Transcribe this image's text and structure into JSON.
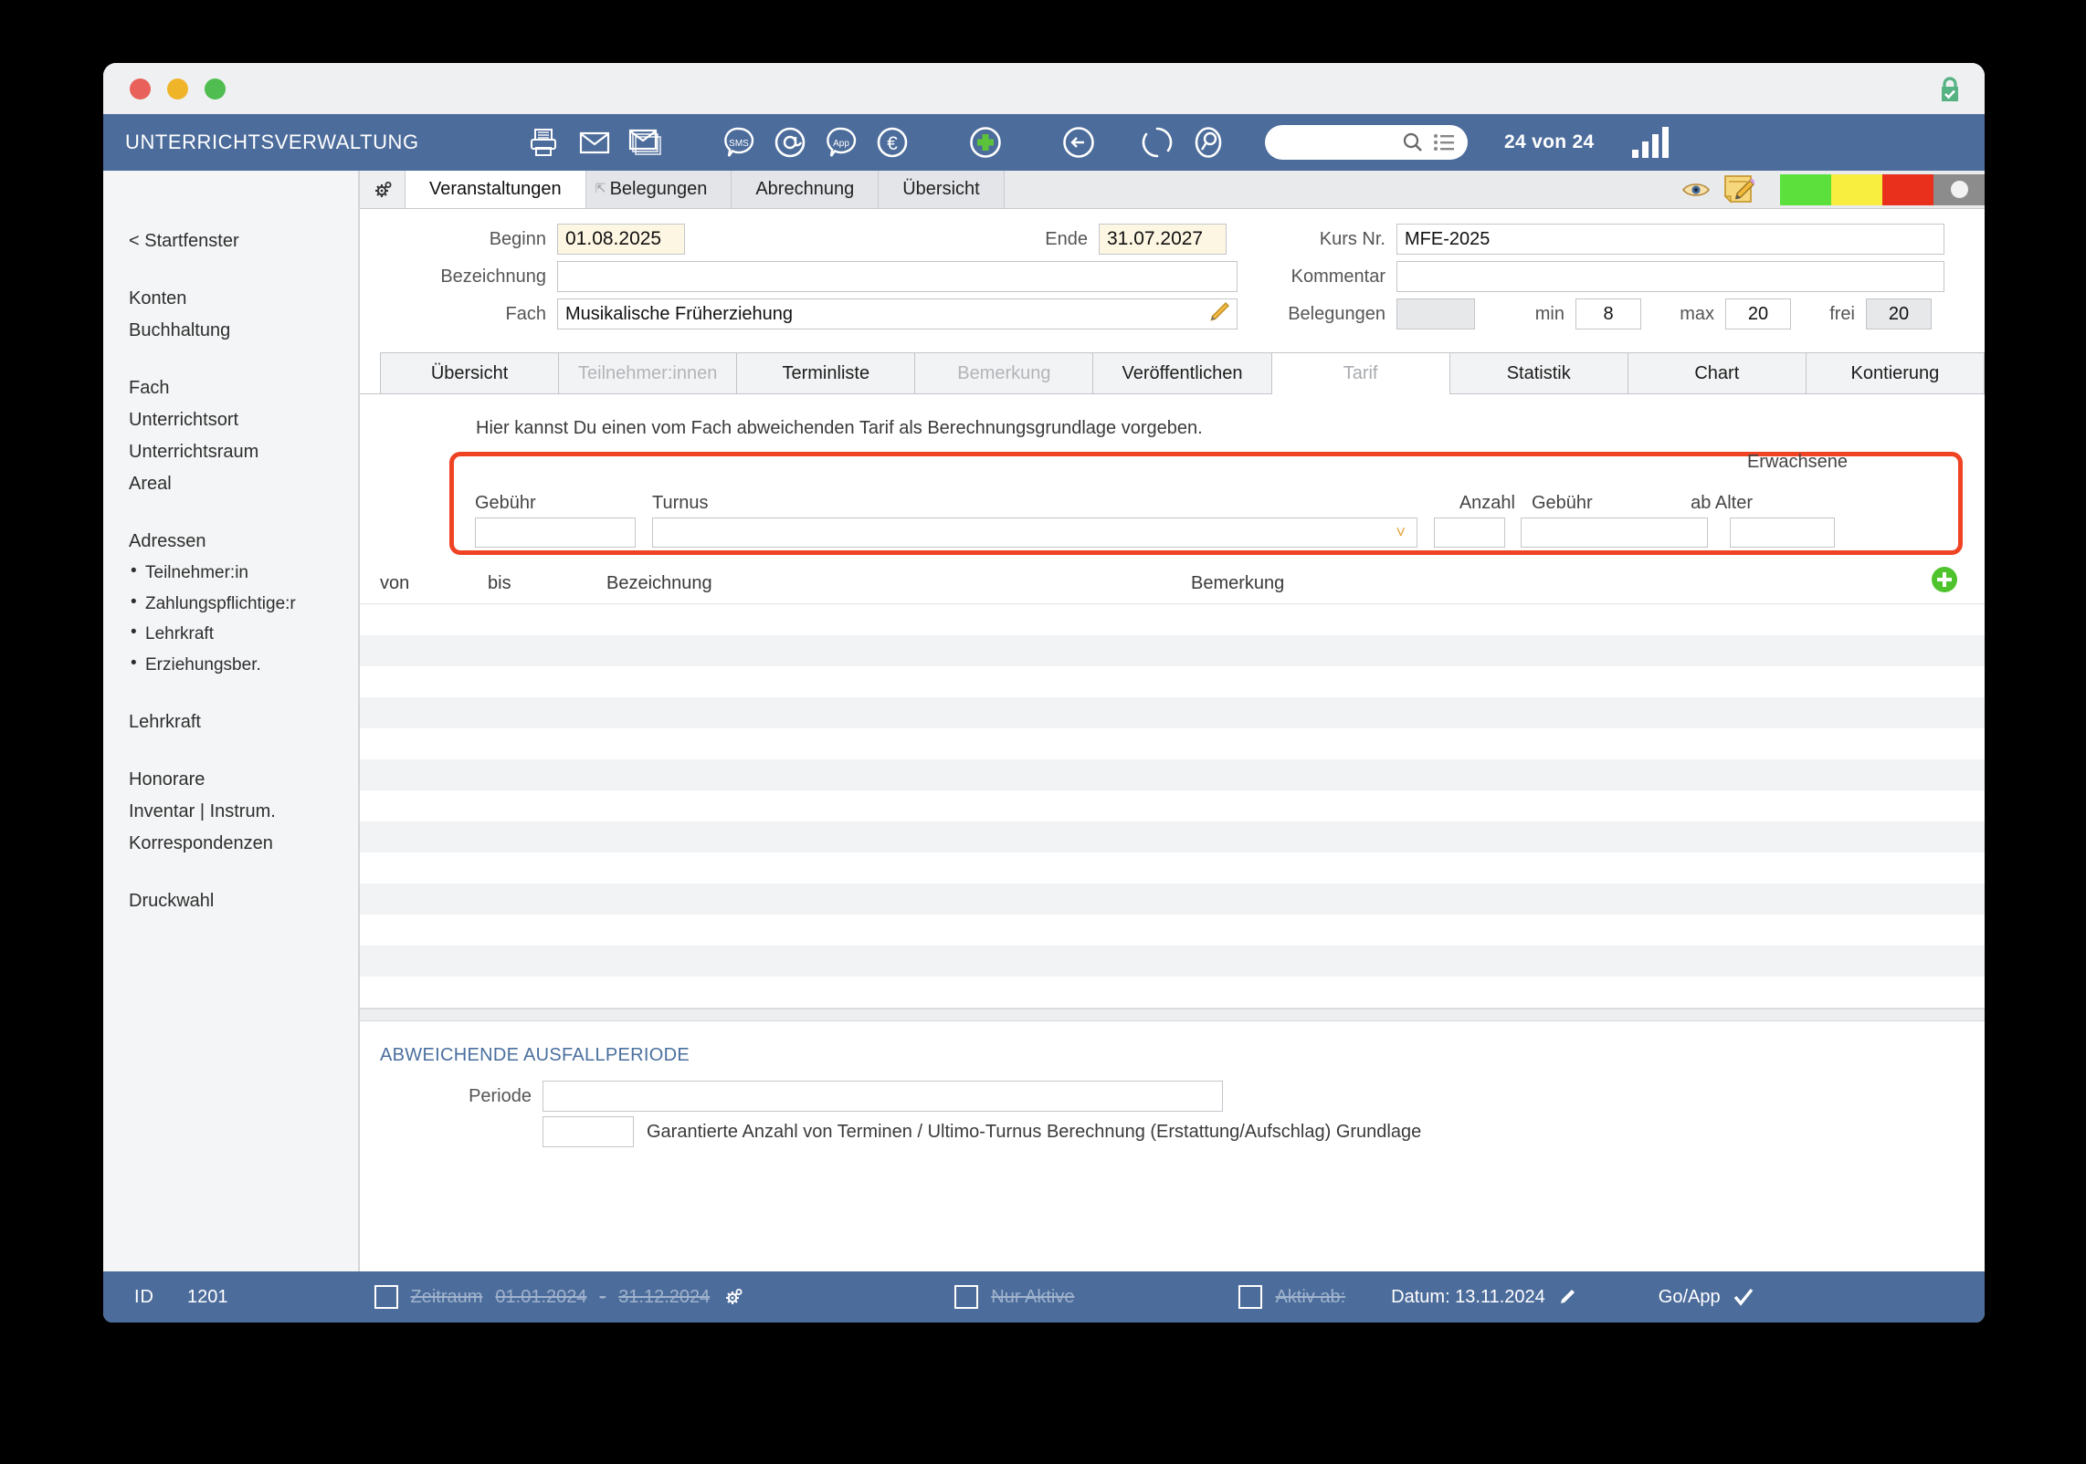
{
  "window": {
    "lock_icon": "lock-secure-icon"
  },
  "header": {
    "app_title": "UNTERRICHTSVERWALTUNG",
    "record_counter": "24 von 24",
    "tools": [
      {
        "name": "print-icon",
        "label": "Drucken"
      },
      {
        "name": "mail-icon",
        "label": "E-Mail"
      },
      {
        "name": "mail-batch-icon",
        "label": "Serienmail"
      },
      {
        "name": "sms-icon",
        "label": "SMS"
      },
      {
        "name": "at-icon",
        "label": "E-Mail Adresse"
      },
      {
        "name": "app-icon",
        "label": "App"
      },
      {
        "name": "euro-icon",
        "label": "Zahlung"
      },
      {
        "name": "add-icon",
        "label": "Neu"
      },
      {
        "name": "back-icon",
        "label": "Zurück"
      },
      {
        "name": "refresh-icon",
        "label": "Aktualisieren"
      },
      {
        "name": "search-record-icon",
        "label": "Suchen"
      }
    ],
    "search": {
      "value": "",
      "placeholder": ""
    },
    "signal_icon": "signal-bars-icon"
  },
  "sidebar": {
    "back_link": "< Startfenster",
    "groups": [
      {
        "items": [
          {
            "label": "Konten"
          },
          {
            "label": "Buchhaltung"
          }
        ]
      },
      {
        "items": [
          {
            "label": "Fach"
          },
          {
            "label": "Unterrichtsort"
          },
          {
            "label": "Unterrichtsraum"
          },
          {
            "label": "Areal"
          }
        ]
      },
      {
        "items": [
          {
            "label": "Adressen"
          }
        ]
      },
      {
        "sub": [
          {
            "label": "Teilnehmer:in"
          },
          {
            "label": "Zahlungspflichtige:r"
          },
          {
            "label": "Lehrkraft"
          },
          {
            "label": "Erziehungsber."
          }
        ]
      },
      {
        "items": [
          {
            "label": "Lehrkraft"
          }
        ]
      },
      {
        "items": [
          {
            "label": "Honorare"
          },
          {
            "label": "Inventar | Instrum."
          },
          {
            "label": "Korrespondenzen"
          }
        ]
      },
      {
        "items": [
          {
            "label": "Druckwahl"
          }
        ]
      }
    ]
  },
  "primary_tabs": {
    "gear_icon": "settings-gear-icon",
    "items": [
      {
        "label": "Veranstaltungen",
        "active": true
      },
      {
        "label": "Belegungen",
        "active": false
      },
      {
        "label": "Abrechnung",
        "active": false
      },
      {
        "label": "Übersicht",
        "active": false
      }
    ]
  },
  "record_actions": {
    "preview_icon": "eye-icon",
    "edit_note_icon": "edit-note-icon",
    "status_colors": [
      "#5ce03b",
      "#f7ee3f",
      "#e8301c",
      "#8c8c8c"
    ]
  },
  "form": {
    "beginn_label": "Beginn",
    "beginn_value": "01.08.2025",
    "ende_label": "Ende",
    "ende_value": "31.07.2027",
    "bezeichnung_label": "Bezeichnung",
    "bezeichnung_value": "",
    "fach_label": "Fach",
    "fach_value": "Musikalische Früherziehung",
    "fach_edit_icon": "pencil-icon",
    "kursnr_label": "Kurs Nr.",
    "kursnr_value": "MFE-2025",
    "kommentar_label": "Kommentar",
    "kommentar_value": "",
    "belegungen_label": "Belegungen",
    "belegungen_value": "",
    "min_label": "min",
    "min_value": "8",
    "max_label": "max",
    "max_value": "20",
    "frei_label": "frei",
    "frei_value": "20"
  },
  "secondary_tabs": [
    {
      "label": "Übersicht",
      "state": "normal"
    },
    {
      "label": "Teilnehmer:innen",
      "state": "disabled"
    },
    {
      "label": "Terminliste",
      "state": "normal"
    },
    {
      "label": "Bemerkung",
      "state": "disabled"
    },
    {
      "label": "Veröffentlichen",
      "state": "normal"
    },
    {
      "label": "Tarif",
      "state": "active"
    },
    {
      "label": "Statistik",
      "state": "normal"
    },
    {
      "label": "Chart",
      "state": "normal"
    },
    {
      "label": "Kontierung",
      "state": "normal"
    }
  ],
  "tarif": {
    "hint": "Hier kannst Du einen vom Fach abweichenden Tarif als Berechnungsgrundlage vorgeben.",
    "highlight_color": "#ef4323",
    "adults_group_label": "Erwachsene",
    "col_gebuehr": "Gebühr",
    "col_turnus": "Turnus",
    "col_anzahl": "Anzahl",
    "col_gebuehr_adult": "Gebühr",
    "col_ab_alter": "ab Alter",
    "gebuehr_value": "",
    "turnus_value": "",
    "anzahl_value": "",
    "gebuehr_adult_value": "",
    "ab_alter_value": "",
    "dropdown_icon": "chevron-down-icon"
  },
  "list": {
    "columns": [
      "von",
      "bis",
      "Bezeichnung",
      "Bemerkung"
    ],
    "add_icon": "add-row-icon",
    "rows": []
  },
  "ausfallperiode": {
    "title": "ABWEICHENDE AUSFALLPERIODE",
    "periode_label": "Periode",
    "periode_value": "",
    "anzahl_value": "",
    "description": "Garantierte Anzahl von Terminen / Ultimo-Turnus Berechnung (Erstattung/Aufschlag) Grundlage"
  },
  "statusbar": {
    "id_label": "ID",
    "id_value": "1201",
    "zeitraum_label": "Zeitraum",
    "zeitraum_from": "01.01.2024",
    "zeitraum_dash": "-",
    "zeitraum_to": "31.12.2024",
    "zeitraum_gear_icon": "settings-gear-icon",
    "nur_aktive_label": "Nur Aktive",
    "aktiv_ab_label": "Aktiv ab:",
    "datum_label": "Datum: 13.11.2024",
    "datum_edit_icon": "pencil-icon",
    "goapp_label": "Go/App",
    "goapp_check_icon": "check-icon"
  }
}
